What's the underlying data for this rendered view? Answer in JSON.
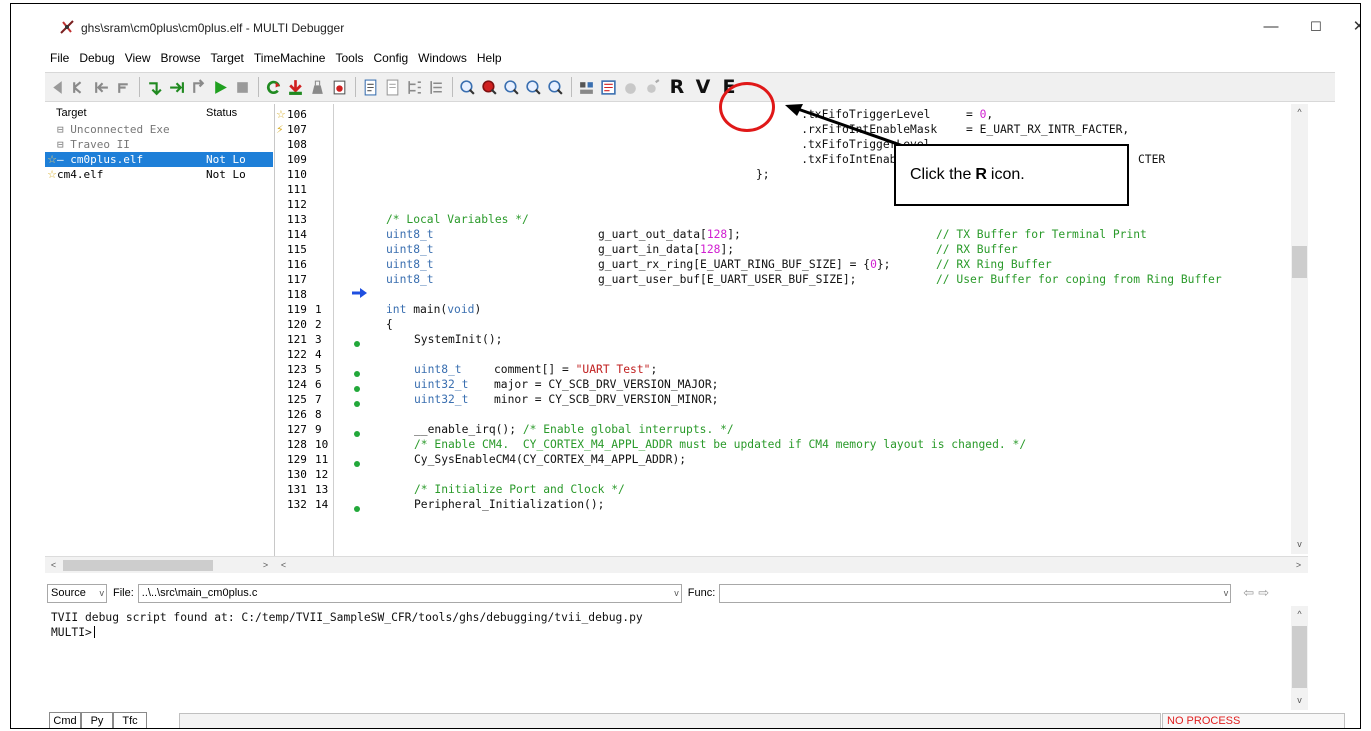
{
  "window": {
    "title": "ghs\\sram\\cm0plus\\cm0plus.elf - MULTI Debugger",
    "minimize_glyph": "—",
    "maximize_glyph": "☐",
    "close_glyph": "✕"
  },
  "menu": [
    "File",
    "Debug",
    "View",
    "Browse",
    "Target",
    "TimeMachine",
    "Tools",
    "Config",
    "Windows",
    "Help"
  ],
  "toolbar": {
    "letters": [
      "R",
      "V",
      "E"
    ]
  },
  "target_panel": {
    "col_target": "Target",
    "col_status": "Status",
    "rows": [
      {
        "text": "⊟ Unconnected Exe",
        "status": ""
      },
      {
        "text": " ⊟ Traveo II",
        "status": ""
      },
      {
        "text": "   — cm0plus.elf",
        "status": "Not Lo"
      },
      {
        "text": "     cm4.elf",
        "status": "Not Lo"
      }
    ]
  },
  "gutter": {
    "lines": [
      {
        "a": "106",
        "b": ""
      },
      {
        "a": "107",
        "b": ""
      },
      {
        "a": "108",
        "b": ""
      },
      {
        "a": "109",
        "b": ""
      },
      {
        "a": "110",
        "b": ""
      },
      {
        "a": "111",
        "b": ""
      },
      {
        "a": "112",
        "b": ""
      },
      {
        "a": "113",
        "b": ""
      },
      {
        "a": "114",
        "b": ""
      },
      {
        "a": "115",
        "b": ""
      },
      {
        "a": "116",
        "b": ""
      },
      {
        "a": "117",
        "b": ""
      },
      {
        "a": "118",
        "b": ""
      },
      {
        "a": "119",
        "b": "1"
      },
      {
        "a": "120",
        "b": "2"
      },
      {
        "a": "121",
        "b": "3"
      },
      {
        "a": "122",
        "b": "4"
      },
      {
        "a": "123",
        "b": "5"
      },
      {
        "a": "124",
        "b": "6"
      },
      {
        "a": "125",
        "b": "7"
      },
      {
        "a": "126",
        "b": "8"
      },
      {
        "a": "127",
        "b": "9"
      },
      {
        "a": "128",
        "b": "10"
      },
      {
        "a": "129",
        "b": "11"
      },
      {
        "a": "130",
        "b": "12"
      },
      {
        "a": "131",
        "b": "13"
      },
      {
        "a": "132",
        "b": "14"
      }
    ]
  },
  "code": {
    "l106_a": "    .txFifoTriggerLevel",
    "l106_b": "= ",
    "l106_n": "0",
    "l106_c": ",",
    "l107_a": "    .rxFifoIntEnableMask",
    "l107_b": "= E_UART_RX_INTR_FACTER,",
    "l108_a": "    .txFifoTriggerLevel",
    "l109_a": "    .txFifoIntEnableMask",
    "l109_b": "CTER",
    "l110_a": "};",
    "l112": "/* Local Variables */",
    "l113_t": "uint8_t",
    "l113_v": "g_uart_out_data[",
    "l113_n": "128",
    "l113_e": "];",
    "l113_c": "// TX Buffer for Terminal Print",
    "l114_t": "uint8_t",
    "l114_v": "g_uart_in_data[",
    "l114_n": "128",
    "l114_e": "];",
    "l114_c": "// RX Buffer",
    "l115_t": "uint8_t",
    "l115_v": "g_uart_rx_ring[E_UART_RING_BUF_SIZE] = {",
    "l115_n": "0",
    "l115_e": "};",
    "l115_c": "// RX Ring Buffer",
    "l116_t": "uint8_t",
    "l116_v": "g_uart_user_buf[E_UART_USER_BUF_SIZE];",
    "l116_c": "// User Buffer for coping from Ring Buffer",
    "l118_k": "int",
    "l118_v": " main(",
    "l118_k2": "void",
    "l118_e": ")",
    "l119": "{",
    "l120": "SystemInit();",
    "l122_t": "uint8_t",
    "l122_v": "comment[] = ",
    "l122_s": "\"UART Test\"",
    "l122_e": ";",
    "l123_t": "uint32_t",
    "l123_v": "major = CY_SCB_DRV_VERSION_MAJOR;",
    "l124_t": "uint32_t",
    "l124_v": "minor = CY_SCB_DRV_VERSION_MINOR;",
    "l126_v": "__enable_irq(); ",
    "l126_c": "/* Enable global interrupts. */",
    "l127_c": "/* Enable CM4.  CY_CORTEX_M4_APPL_ADDR must be updated if CM4 memory layout is changed. */",
    "l128": "Cy_SysEnableCM4(CY_CORTEX_M4_APPL_ADDR);",
    "l130_c": "/* Initialize Port and Clock */",
    "l131": "Peripheral_Initialization();"
  },
  "source_bar": {
    "mode": "Source",
    "file_label": "File:",
    "file_value": "..\\..\\src\\main_cm0plus.c",
    "func_label": "Func:",
    "func_value": ""
  },
  "command_pane": {
    "line1": "TVII debug script found at: C:/temp/TVII_SampleSW_CFR/tools/ghs/debugging/tvii_debug.py",
    "prompt": "MULTI>"
  },
  "bottom_tabs": [
    "Cmd",
    "Py",
    "Tfc"
  ],
  "status": "NO PROCESS",
  "annotation": {
    "pre": "Click the",
    "bold": "R",
    "post": "icon."
  },
  "colors": {
    "selection": "#1e7fd8",
    "annotation_ring": "#e01818",
    "status_text": "#e02020",
    "comment": "#2a9a2a",
    "keyword": "#3a6fb0",
    "number": "#d020d0"
  }
}
